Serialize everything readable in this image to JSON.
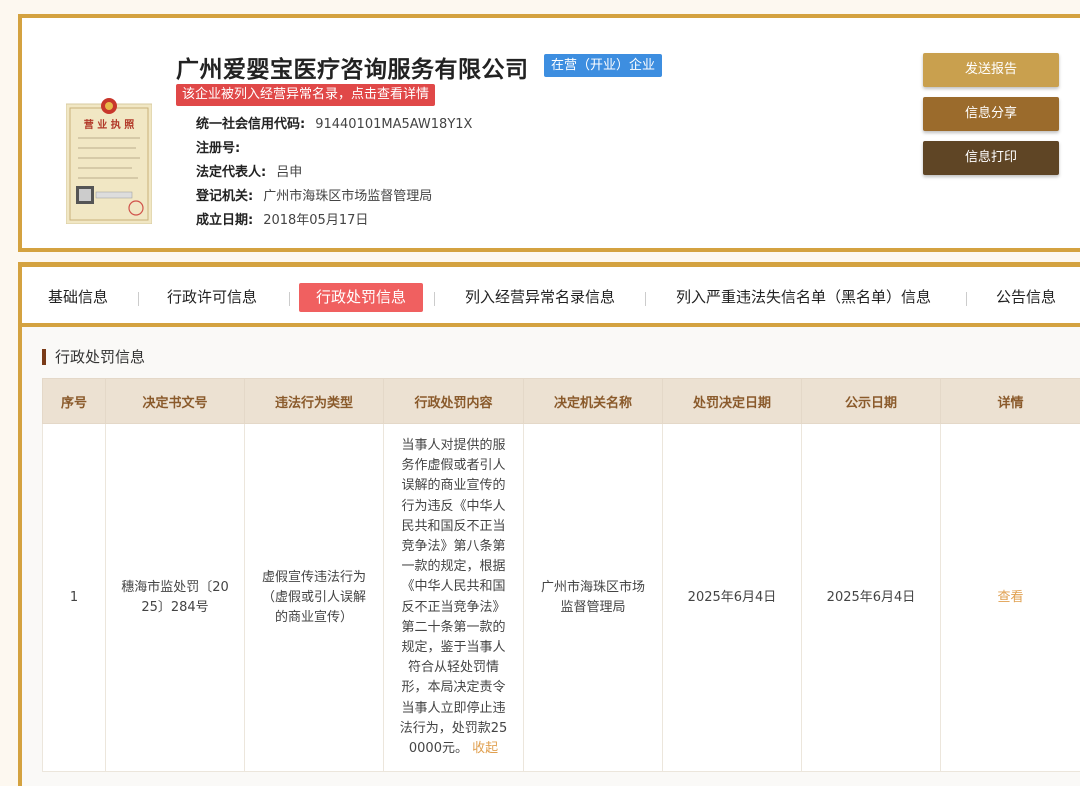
{
  "company": {
    "name": "广州爱婴宝医疗咨询服务有限公司",
    "status": "在营（开业）企业",
    "warning": "该企业被列入经营异常名录，点击查看详情",
    "license_title": "营 业 执 照",
    "info": [
      {
        "label": "统一社会信用代码:",
        "value": "91440101MA5AW18Y1X"
      },
      {
        "label": "注册号:",
        "value": ""
      },
      {
        "label": "法定代表人:",
        "value": "吕申"
      },
      {
        "label": "登记机关:",
        "value": "广州市海珠区市场监督管理局"
      },
      {
        "label": "成立日期:",
        "value": "2018年05月17日"
      }
    ]
  },
  "actions": {
    "report": "发送报告",
    "share": "信息分享",
    "print": "信息打印"
  },
  "tabs": [
    {
      "label": "基础信息",
      "active": false
    },
    {
      "label": "行政许可信息",
      "active": false
    },
    {
      "label": "行政处罚信息",
      "active": true
    },
    {
      "label": "列入经营异常名录信息",
      "active": false
    },
    {
      "label": "列入严重违法失信名单（黑名单）信息",
      "active": false
    },
    {
      "label": "公告信息",
      "active": false
    }
  ],
  "section": {
    "title": "行政处罚信息"
  },
  "table": {
    "headers": [
      "序号",
      "决定书文号",
      "违法行为类型",
      "行政处罚内容",
      "决定机关名称",
      "处罚决定日期",
      "公示日期",
      "详情"
    ],
    "rows": [
      {
        "no": "1",
        "doc_lines": [
          "穗海市监处罚〔20",
          "25〕284号"
        ],
        "type_lines": [
          "虚假宣传违法行为",
          "（虚假或引人误解",
          "的商业宣传）"
        ],
        "content_lines": [
          "当事人对提供的服",
          "务作虚假或者引人",
          "误解的商业宣传的",
          "行为违反《中华人",
          "民共和国反不正当",
          "竞争法》第八条第",
          "一款的规定，根据",
          "《中华人民共和国",
          "反不正当竞争法》",
          "第二十条第一款的",
          "规定，鉴于当事人",
          "符合从轻处罚情",
          "形，本局决定责令",
          "当事人立即停止违",
          "法行为，处罚款25",
          "0000元。"
        ],
        "collapse": "收起",
        "authority_lines": [
          "广州市海珠区市场",
          "监督管理局"
        ],
        "decision_date": "2025年6月4日",
        "publish_date": "2025年6月4日",
        "detail": "查看"
      }
    ]
  },
  "colors": {
    "gold_border": "#d4a240",
    "status_blue": "#3d8ee0",
    "warning_red": "#e04848",
    "active_tab": "#f06060",
    "header_bg": "#ece1d2",
    "header_text": "#8a5a2b",
    "link": "#e0a050"
  }
}
